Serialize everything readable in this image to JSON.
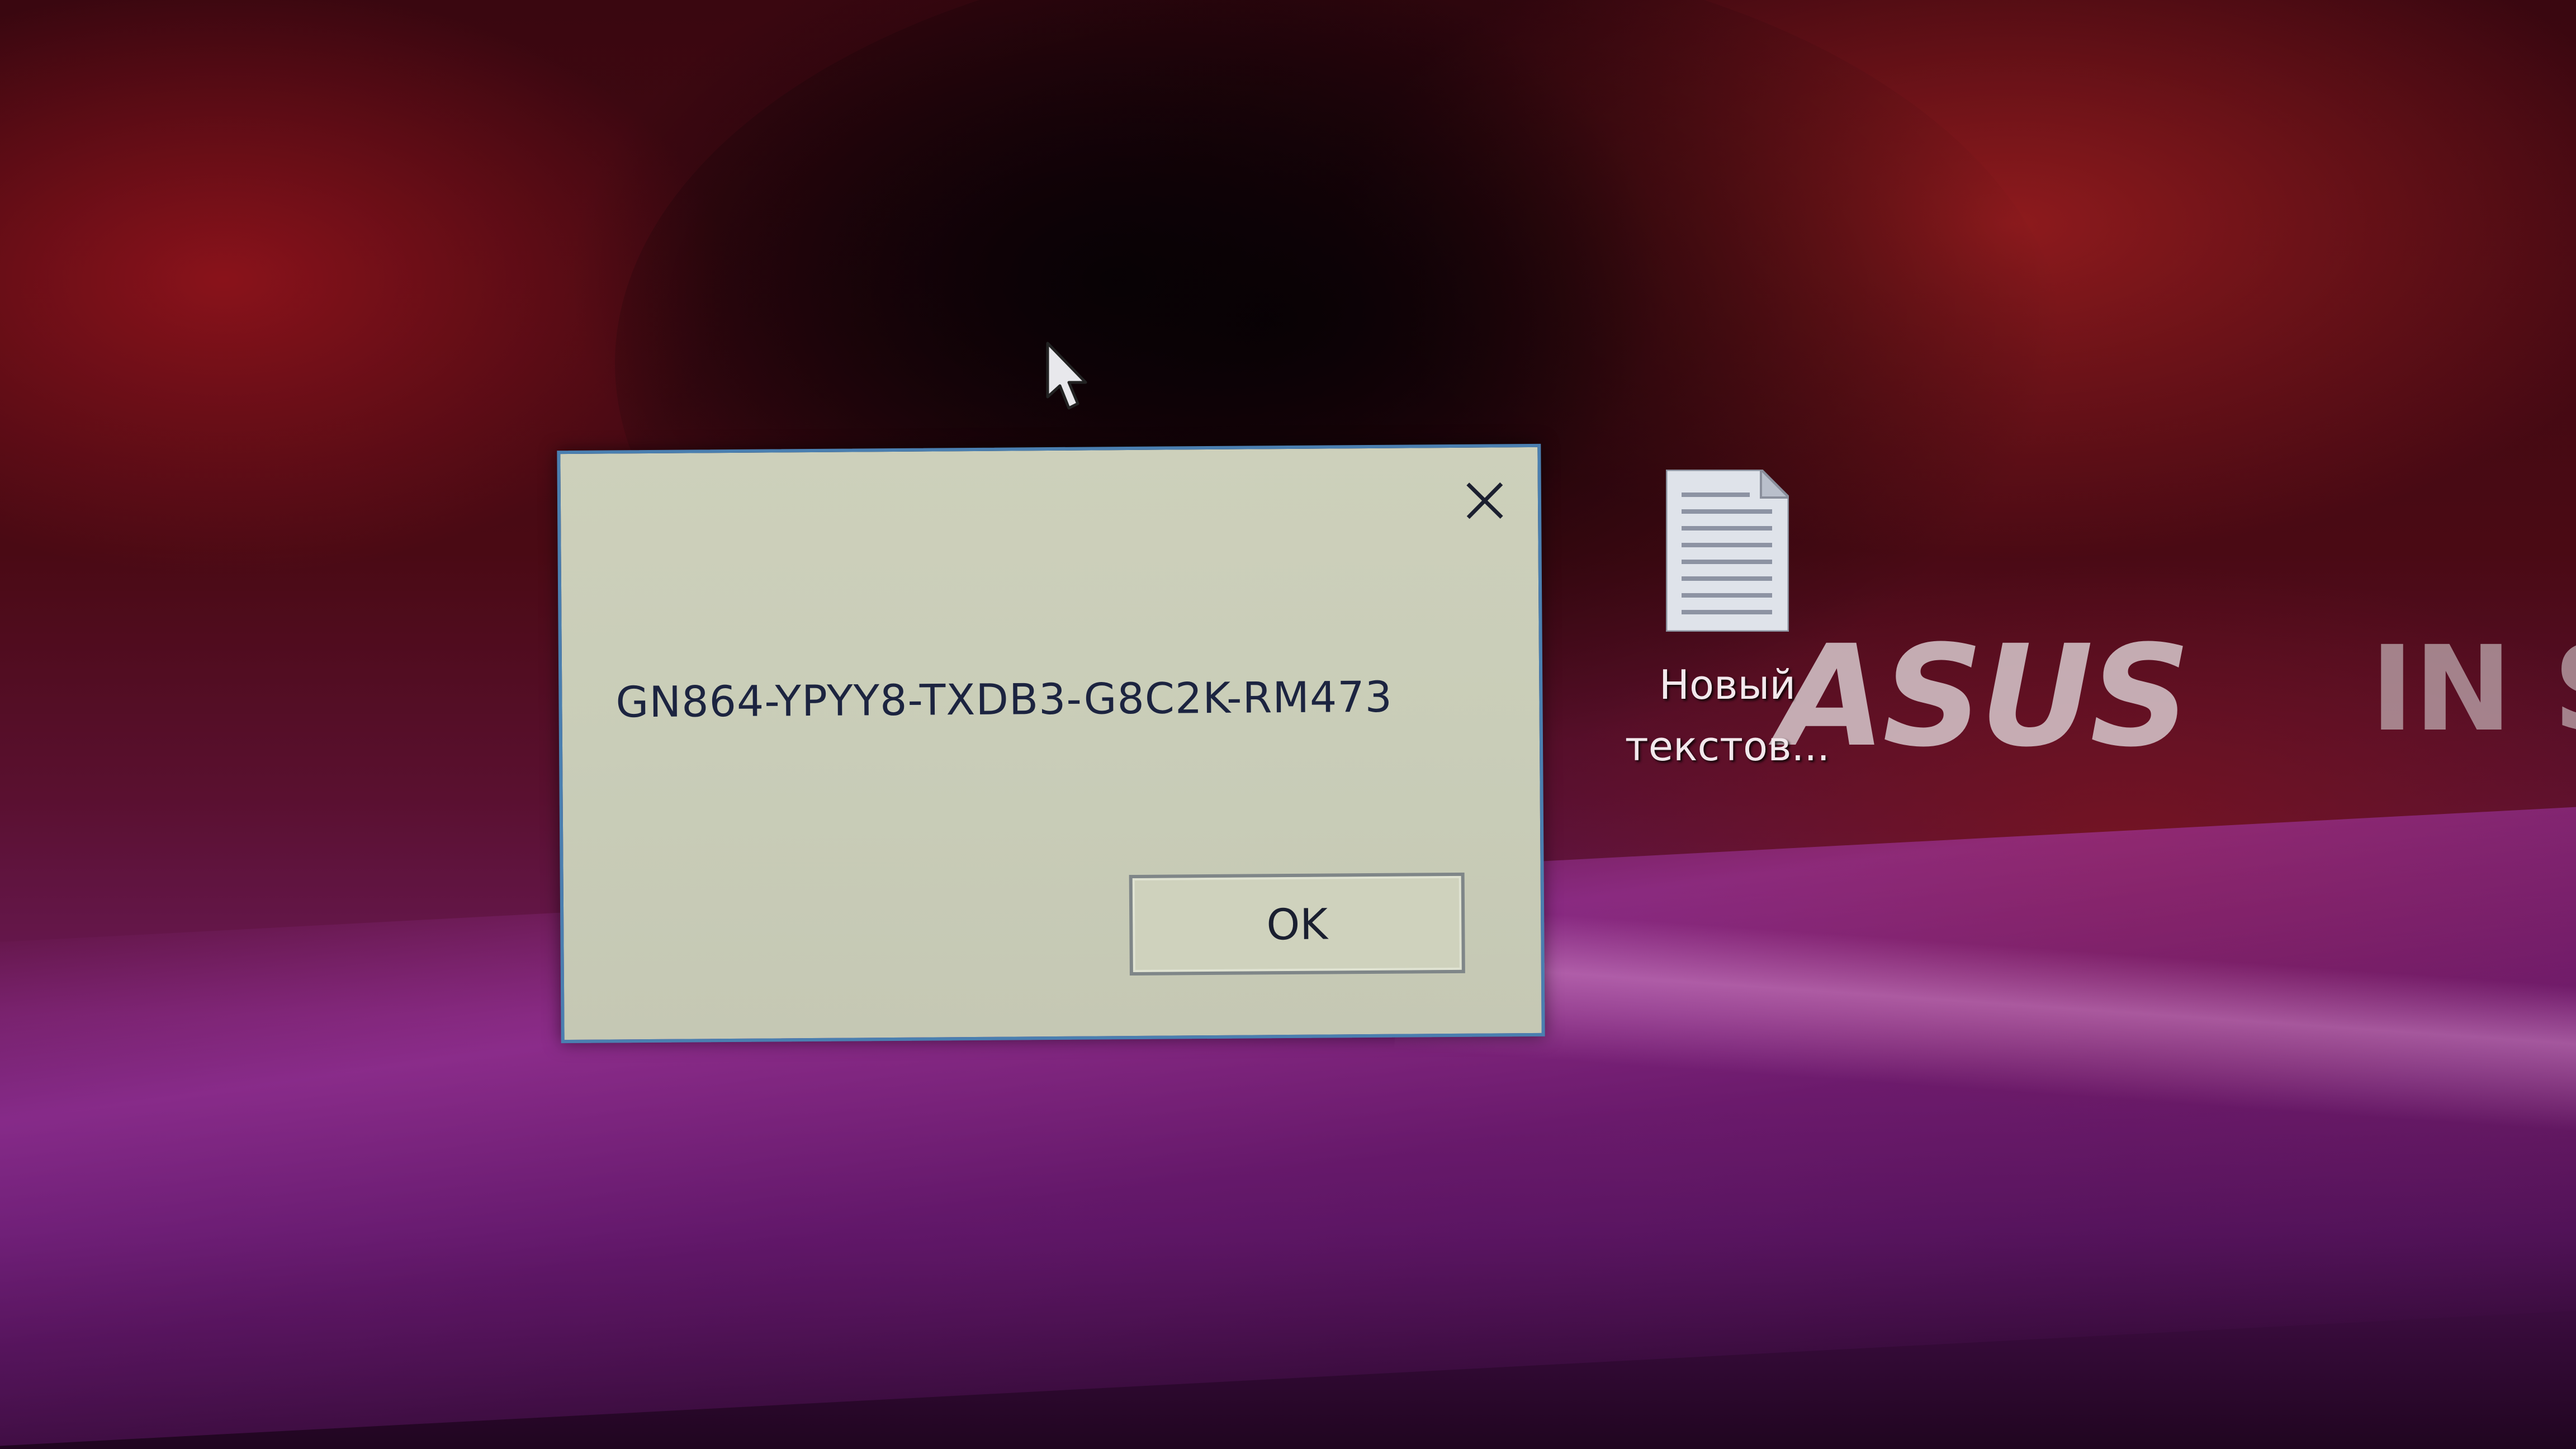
{
  "desktop": {
    "brand_logo": "ASUS",
    "brand_tagline": "IN SE",
    "icons": [
      {
        "label": "Новый текстов...",
        "icon": "text-document-icon"
      }
    ]
  },
  "dialog": {
    "message": "GN864-YPYY8-TXDB3-G8C2K-RM473",
    "ok_label": "OK",
    "close_icon": "close-icon",
    "border_color": "#4a7fb0",
    "background_color": "#cdd0bb"
  },
  "cursor": {
    "icon": "arrow-cursor-icon"
  }
}
